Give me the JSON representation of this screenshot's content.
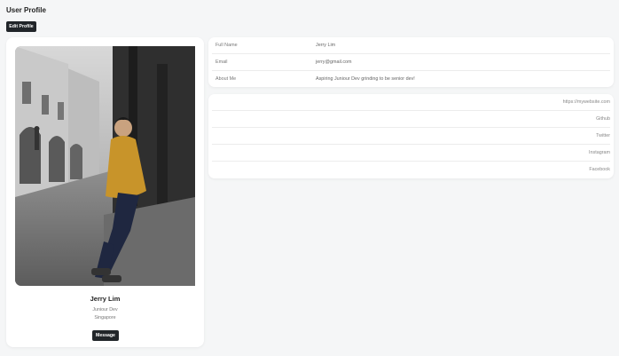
{
  "header": {
    "title": "User Profile",
    "edit_label": "Edit Profile"
  },
  "profile": {
    "name": "Jerry Lim",
    "role": "Juniour Dev",
    "location": "Singapore",
    "message_label": "Message"
  },
  "info": [
    {
      "label": "Full Name",
      "value": "Jerry Lim"
    },
    {
      "label": "Email",
      "value": "jerry@gmail.com"
    },
    {
      "label": "About Me",
      "value": "Aspiring Juniour Dev grinding to be senior dev!"
    }
  ],
  "links": [
    {
      "label": "https://mywebsite.com"
    },
    {
      "label": "Github"
    },
    {
      "label": "Twitter"
    },
    {
      "label": "Instagram"
    },
    {
      "label": "Facebook"
    }
  ]
}
